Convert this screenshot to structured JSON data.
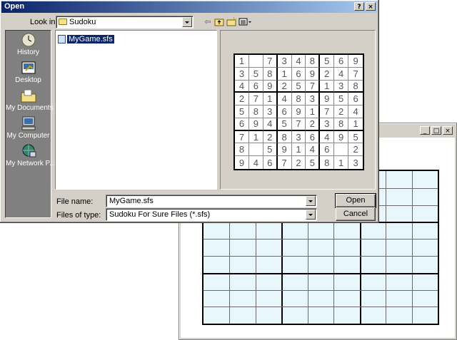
{
  "app_window": {
    "buttons": [
      "_",
      "□",
      "×"
    ]
  },
  "dialog": {
    "title": "Open",
    "caption_buttons": [
      "?",
      "×"
    ],
    "look_in_label": "Look in:",
    "look_in_value": "Sudoku",
    "toolbar_icons": [
      "back-arrow-icon",
      "up-folder-icon",
      "new-folder-icon",
      "view-menu-icon"
    ],
    "places": [
      {
        "label": "History",
        "icon": "history-icon"
      },
      {
        "label": "Desktop",
        "icon": "desktop-icon"
      },
      {
        "label": "My Documents",
        "icon": "my-documents-icon"
      },
      {
        "label": "My Computer",
        "icon": "my-computer-icon"
      },
      {
        "label": "My Network P...",
        "icon": "my-network-places-icon"
      }
    ],
    "files": [
      {
        "name": "MyGame.sfs",
        "selected": true
      }
    ],
    "preview_grid": [
      [
        "1",
        "",
        "7",
        "3",
        "4",
        "8",
        "5",
        "6",
        "9"
      ],
      [
        "3",
        "5",
        "8",
        "1",
        "6",
        "9",
        "2",
        "4",
        "7"
      ],
      [
        "4",
        "6",
        "9",
        "2",
        "5",
        "7",
        "1",
        "3",
        "8"
      ],
      [
        "2",
        "7",
        "1",
        "4",
        "8",
        "3",
        "9",
        "5",
        "6"
      ],
      [
        "5",
        "8",
        "3",
        "6",
        "9",
        "1",
        "7",
        "2",
        "4"
      ],
      [
        "6",
        "9",
        "4",
        "5",
        "7",
        "2",
        "3",
        "8",
        "1"
      ],
      [
        "7",
        "1",
        "2",
        "8",
        "3",
        "6",
        "4",
        "9",
        "5"
      ],
      [
        "8",
        "",
        "5",
        "9",
        "1",
        "4",
        "6",
        "",
        "2"
      ],
      [
        "9",
        "4",
        "6",
        "7",
        "2",
        "5",
        "8",
        "1",
        "3"
      ]
    ],
    "file_name_label": "File name:",
    "file_name_value": "MyGame.sfs",
    "file_type_label": "Files of type:",
    "file_type_value": "Sudoku For Sure Files (*.sfs)",
    "open_label": "Open",
    "cancel_label": "Cancel"
  },
  "colors": {
    "caption_start": "#0a246a",
    "caption_end": "#a6caf0",
    "face": "#d4d0c8",
    "grid_fill": "#e8f7fb"
  }
}
